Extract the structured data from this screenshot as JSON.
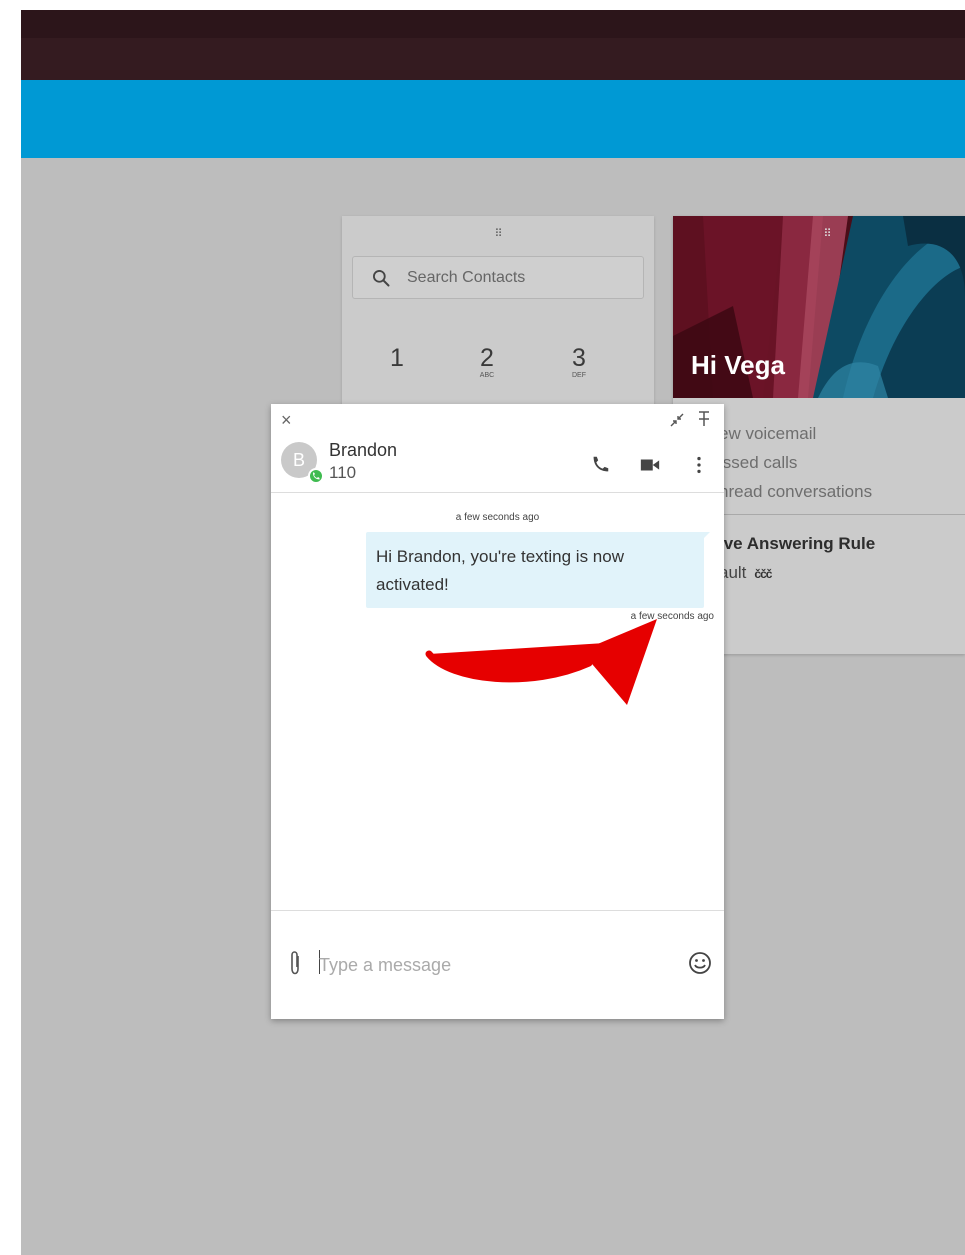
{
  "colors": {
    "topbar": "#341b20",
    "accent_bar": "#0099d4",
    "background": "#bdbdbd",
    "bubble": "#e1f3fa",
    "presence": "#3fbb50",
    "annotation_arrow": "#e60000"
  },
  "dialpad": {
    "search_placeholder": "Search Contacts",
    "keys": [
      {
        "num": "1",
        "letters": ""
      },
      {
        "num": "2",
        "letters": "ABC"
      },
      {
        "num": "3",
        "letters": "DEF"
      }
    ]
  },
  "welcome": {
    "greeting": "Hi Vega",
    "stats": [
      "ew voicemail",
      "issed calls",
      "nread conversations"
    ],
    "rule_title": "ive Answering Rule",
    "rule_value": "ault"
  },
  "chat": {
    "contact_name": "Brandon",
    "avatar_initial": "B",
    "extension": "110",
    "conversation_timestamp": "a few seconds ago",
    "message_text": "Hi Brandon, you're texting is now activated!",
    "message_timestamp": "a few seconds ago",
    "input_placeholder": "Type a message"
  },
  "icons": [
    "close-icon",
    "minimize-icon",
    "pin-icon",
    "phone-icon",
    "video-icon",
    "more-vert-icon",
    "search-icon",
    "drag-handle-icon",
    "attach-icon",
    "emoji-icon",
    "rule-status-icon"
  ]
}
